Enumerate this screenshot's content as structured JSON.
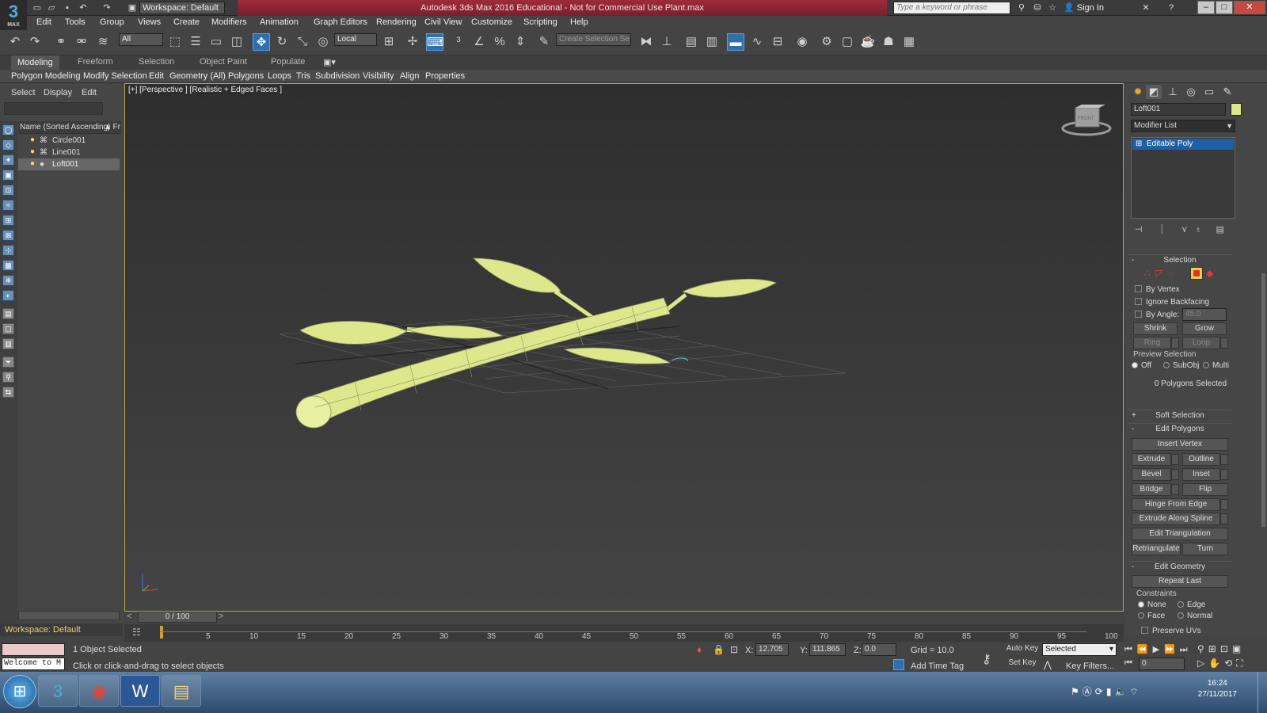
{
  "titlebar": {
    "workspace_label": "Workspace: Default",
    "title": "Autodesk 3ds Max 2016 Educational - Not for Commercial Use    Plant.max",
    "search_placeholder": "Type a keyword or phrase",
    "sign_in": "Sign In",
    "logo_text": "MAX"
  },
  "menu": [
    "Edit",
    "Tools",
    "Group",
    "Views",
    "Create",
    "Modifiers",
    "Animation",
    "Graph Editors",
    "Rendering",
    "Civil View",
    "Customize",
    "Scripting",
    "Help"
  ],
  "toolbar": {
    "filter_value": "All",
    "coord_value": "Local",
    "selection_set_placeholder": "Create Selection Se"
  },
  "ribbon": {
    "tabs": [
      "Modeling",
      "Freeform",
      "Selection",
      "Object Paint",
      "Populate"
    ],
    "panel_items": [
      "Polygon Modeling",
      "Modify Selection",
      "Edit",
      "Geometry (All)",
      "Polygons",
      "Loops",
      "Tris",
      "Subdivision",
      "Visibility",
      "Align",
      "Properties"
    ]
  },
  "scene_explorer": {
    "tabs": [
      "Select",
      "Display",
      "Edit"
    ],
    "column_header": "Name (Sorted Ascending)",
    "column_header2": "Fr",
    "objects": [
      "Circle001",
      "Line001",
      "Loft001"
    ],
    "selected": "Loft001"
  },
  "viewport": {
    "label": "[+] [Perspective ] [Realistic + Edged Faces ]",
    "leaf_color": "#dde78c",
    "border_color": "#b9a94a",
    "viewcube_label": "FRONT"
  },
  "command_panel": {
    "object_name": "Loft001",
    "object_color": "#dde78c",
    "modifier_list": "Modifier List",
    "stack_item": "Editable Poly",
    "selection": {
      "title": "Selection",
      "by_vertex": "By Vertex",
      "ignore_backfacing": "Ignore Backfacing",
      "by_angle": "By Angle:",
      "by_angle_value": "45.0",
      "shrink": "Shrink",
      "grow": "Grow",
      "ring": "Ring",
      "loop": "Loop",
      "preview_selection": "Preview Selection",
      "preview_off": "Off",
      "preview_subobj": "SubObj",
      "preview_multi": "Multi",
      "status": "0 Polygons Selected"
    },
    "soft_selection": "Soft Selection",
    "edit_polygons": {
      "title": "Edit Polygons",
      "insert_vertex": "Insert Vertex",
      "extrude": "Extrude",
      "outline": "Outline",
      "bevel": "Bevel",
      "inset": "Inset",
      "bridge": "Bridge",
      "flip": "Flip",
      "hinge_from_edge": "Hinge From Edge",
      "extrude_along_spline": "Extrude Along Spline",
      "edit_triangulation": "Edit Triangulation",
      "retriangulate": "Retriangulate",
      "turn": "Turn"
    },
    "edit_geometry": {
      "title": "Edit Geometry",
      "repeat_last": "Repeat Last",
      "constraints": "Constraints",
      "none": "None",
      "edge": "Edge",
      "face": "Face",
      "normal": "Normal",
      "preserve_uvs": "Preserve UVs"
    }
  },
  "timeline": {
    "frame_display": "0 / 100",
    "ticks": [
      "5",
      "10",
      "15",
      "20",
      "25",
      "30",
      "35",
      "40",
      "45",
      "50",
      "55",
      "60",
      "65",
      "70",
      "75",
      "80",
      "85",
      "90",
      "95",
      "100"
    ],
    "workspace_label": "Workspace: Default"
  },
  "status": {
    "objects_selected": "1 Object Selected",
    "prompt": "Click or click-and-drag to select objects",
    "maxscript": "Welcome to M",
    "x_label": "X:",
    "x_value": "12.705",
    "y_label": "Y:",
    "y_value": "111.865",
    "z_label": "Z:",
    "z_value": "0.0",
    "grid": "Grid = 10.0",
    "add_time_tag": "Add Time Tag",
    "auto_key": "Auto Key",
    "set_key": "Set Key",
    "selected_dd": "Selected",
    "key_filters": "Key Filters...",
    "frame_value": "0"
  },
  "taskbar": {
    "time": "16:24",
    "date": "27/11/2017"
  }
}
